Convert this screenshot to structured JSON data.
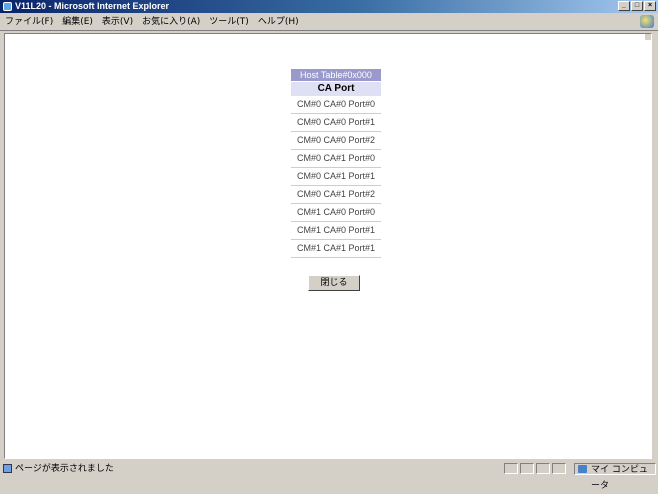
{
  "window": {
    "title": "V11L20 - Microsoft Internet Explorer",
    "controls": [
      "_",
      "□",
      "×"
    ]
  },
  "menu": [
    "ファイル(F)",
    "編集(E)",
    "表示(V)",
    "お気に入り(A)",
    "ツール(T)",
    "ヘルプ(H)"
  ],
  "table": {
    "title": "Host Table#0x000",
    "column": "CA Port",
    "rows": [
      "CM#0 CA#0 Port#0",
      "CM#0 CA#0 Port#1",
      "CM#0 CA#0 Port#2",
      "CM#0 CA#1 Port#0",
      "CM#0 CA#1 Port#1",
      "CM#0 CA#1 Port#2",
      "CM#1 CA#0 Port#0",
      "CM#1 CA#0 Port#1",
      "CM#1 CA#1 Port#1"
    ]
  },
  "close_button": "閉じる",
  "status": {
    "text": "ページが表示されました",
    "zone": "マイ コンピュータ"
  }
}
